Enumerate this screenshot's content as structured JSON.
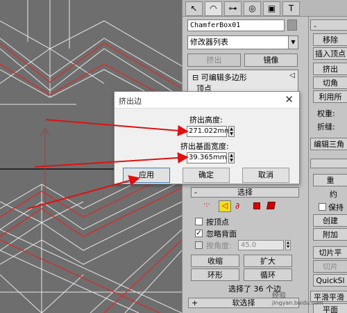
{
  "panel": {
    "tabs": [
      {
        "icon": "cursor-icon",
        "glyph": "↖"
      },
      {
        "icon": "modify-icon",
        "glyph": "◠"
      },
      {
        "icon": "hierarchy-icon",
        "glyph": "⊶"
      },
      {
        "icon": "motion-icon",
        "glyph": "◎"
      },
      {
        "icon": "display-icon",
        "glyph": "▣"
      },
      {
        "icon": "utilities-icon",
        "glyph": "T"
      }
    ],
    "object_name": "ChamferBox01",
    "modifier_list": "修改器列表",
    "extrude_btn": "挤出",
    "mirror_btn": "镜像",
    "stack": {
      "item": "可编辑多边形",
      "collapse": "⊟",
      "sub": "顶点"
    },
    "select_header": "选择",
    "vertex_check_label": "按顶点",
    "ignore_back_label": "忽略背面",
    "angle_label": "按角度:",
    "angle_value": "45.0",
    "shrink_btn": "收缩",
    "grow_btn": "扩大",
    "ring_btn": "环形",
    "loop_btn": "循环",
    "selected_text": "选择了 36 个边",
    "soft_select_header": "软选择"
  },
  "right_col": {
    "header_minus": "-",
    "move": "移除",
    "insert_vertex": "插入顶点",
    "extrude": "挤出",
    "chamfer": "切角",
    "use_all": "利用所",
    "weight": "权重:",
    "crease": "折缝:",
    "edit_tri": "编辑三角",
    "reset": "重",
    "constrain": "约",
    "keep": "保持",
    "create": "创建",
    "attach": "附加",
    "slice_plane": "切片平",
    "slice": "切片",
    "quickslice": "QuickSl",
    "smooth": "平滑平滑",
    "plane": "平面"
  },
  "dialog": {
    "title": "挤出边",
    "height_label": "挤出高度:",
    "height_value": "271.022mm",
    "base_width_label": "挤出基面宽度:",
    "base_width_value": "39.365mm",
    "apply": "应用",
    "ok": "确定",
    "cancel": "取消",
    "close": "✕"
  },
  "watermark": {
    "line1": "经验",
    "line2": "jingyan.baidu.com"
  },
  "colors": {
    "annotation_arrow": "#e01010",
    "viewport_bg": "#6e6e6e",
    "selected_edge": "#d03030"
  }
}
